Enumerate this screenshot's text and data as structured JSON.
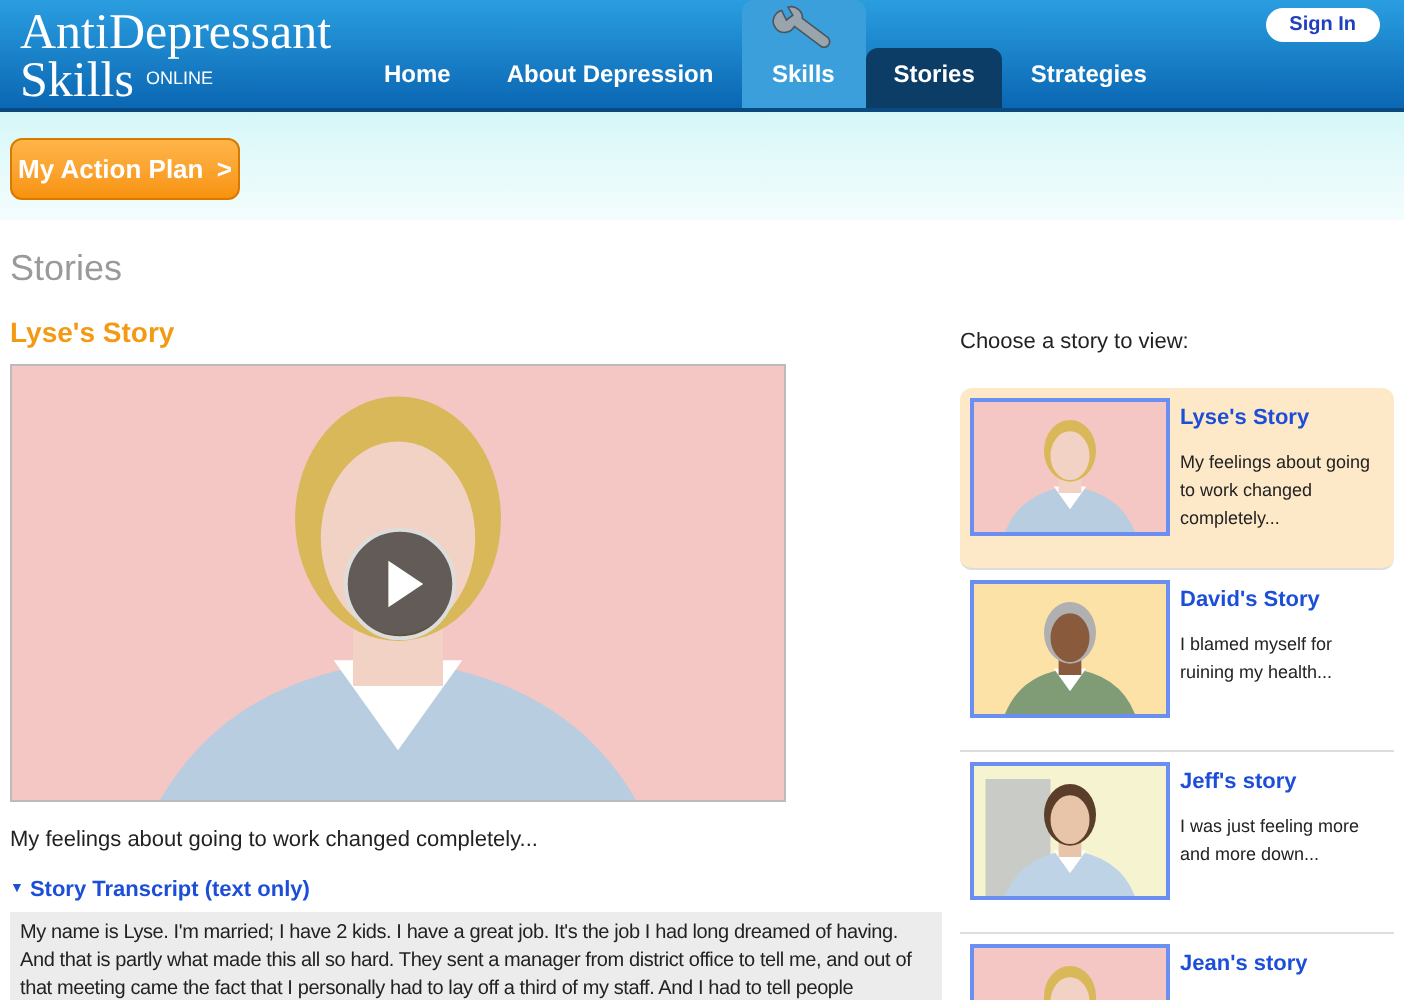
{
  "logo": {
    "line1": "AntiDepressant",
    "line2": "Skills",
    "tag": "ONLINE"
  },
  "nav": [
    {
      "label": "Home",
      "kind": "plain",
      "selected": false
    },
    {
      "label": "About Depression",
      "kind": "plain",
      "selected": false
    },
    {
      "label": "Skills",
      "kind": "featured",
      "selected": false
    },
    {
      "label": "Stories",
      "kind": "plain",
      "selected": true
    },
    {
      "label": "Strategies",
      "kind": "plain",
      "selected": false
    }
  ],
  "sign_in": "Sign In",
  "action_plan": {
    "label": "My Action Plan",
    "arrow": ">"
  },
  "page_title": "Stories",
  "story_title": "Lyse's Story",
  "caption": "My feelings about going to work changed completely...",
  "transcript": {
    "caret": "▼",
    "label": "Story Transcript (text only)",
    "expanded": true,
    "text": "My name is Lyse. I'm married; I have 2 kids. I have a great job. It's the job I had long dreamed of having. And that is partly what made this all so hard. They sent a manager from district office to tell me, and out of that meeting came the fact that I personally had to lay off a third of my staff. And I had to tell people"
  },
  "choose_label": "Choose a story to view:",
  "stories": [
    {
      "title": "Lyse's Story",
      "summary": "My feelings about going to work changed completely...",
      "selected": true
    },
    {
      "title": "David's Story",
      "summary": "I blamed myself for ruining my health...",
      "selected": false
    },
    {
      "title": "Jeff's story",
      "summary": "I was just feeling more and more down...",
      "selected": false
    },
    {
      "title": "Jean's story",
      "selected": false
    }
  ]
}
